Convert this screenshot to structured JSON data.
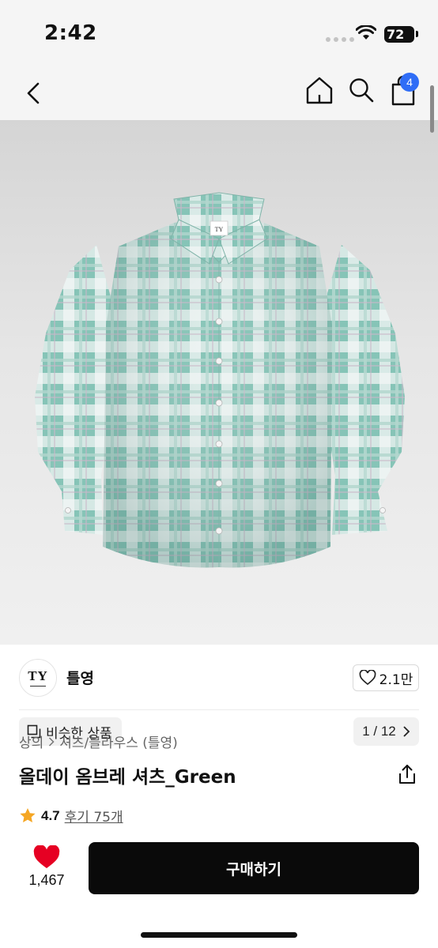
{
  "status_bar": {
    "time": "2:42",
    "battery": "72"
  },
  "nav": {
    "cart_badge": "4"
  },
  "gallery": {
    "similar_label": "비슷한 상품",
    "page_counter": "1 / 12",
    "shirt_logo": "TY"
  },
  "brand": {
    "logo": "TY",
    "name": "틀영",
    "likes": "2.1만"
  },
  "product": {
    "breadcrumb_category": "상의",
    "breadcrumb_sub": "셔츠/블라우스 (틀영)",
    "title": "올데이 옴브레 셔츠_Green",
    "rating": "4.7",
    "reviews": "후기 75개"
  },
  "bottom": {
    "wish_count": "1,467",
    "buy_label": "구매하기"
  },
  "colors": {
    "heart": "#e60023",
    "star": "#f5a623",
    "badge": "#2f6df6",
    "shirt": "#8fc9bd"
  }
}
